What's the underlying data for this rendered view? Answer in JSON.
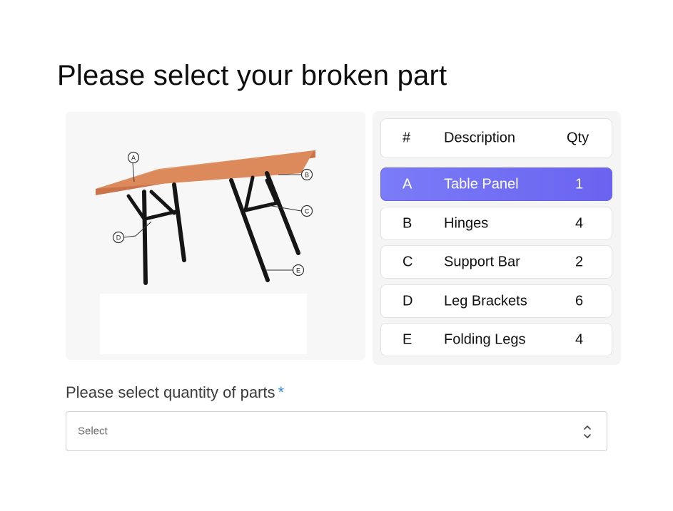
{
  "page": {
    "title": "Please select your broken part"
  },
  "diagram": {
    "callouts": [
      "A",
      "B",
      "C",
      "D",
      "E"
    ]
  },
  "parts_table": {
    "headers": {
      "id": "#",
      "description": "Description",
      "qty": "Qty"
    },
    "selected_id": "A",
    "rows": [
      {
        "id": "A",
        "description": "Table Panel",
        "qty": "1"
      },
      {
        "id": "B",
        "description": "Hinges",
        "qty": "4"
      },
      {
        "id": "C",
        "description": "Support Bar",
        "qty": "2"
      },
      {
        "id": "D",
        "description": "Leg Brackets",
        "qty": "6"
      },
      {
        "id": "E",
        "description": "Folding Legs",
        "qty": "4"
      }
    ]
  },
  "quantity": {
    "label": "Please select quantity of parts",
    "required_mark": "*",
    "placeholder": "Select",
    "icon": "chevron-up-down-icon"
  },
  "colors": {
    "accent": "#6a63f0",
    "required": "#2f8de4",
    "wood": "#d9885a"
  }
}
